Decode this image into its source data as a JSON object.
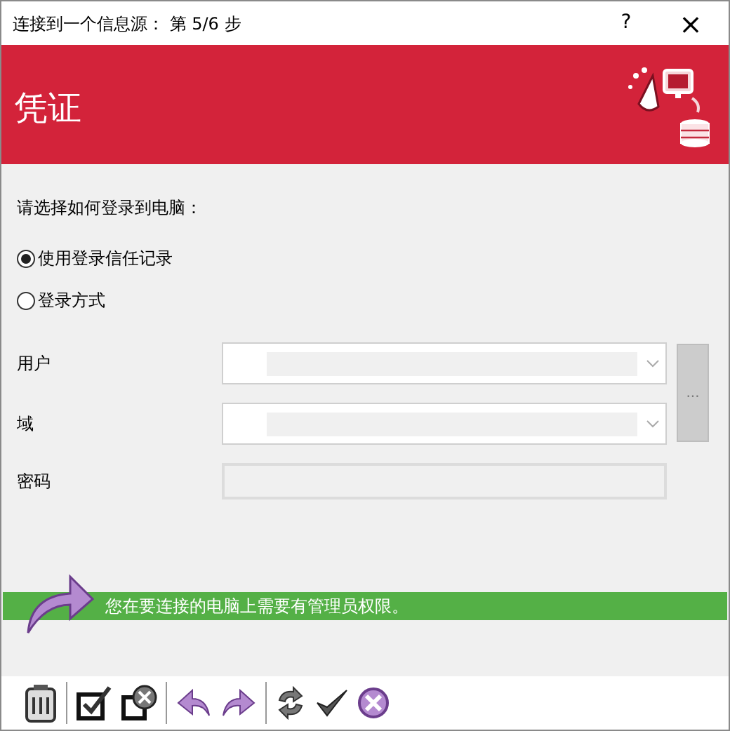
{
  "window": {
    "title": "连接到一个信息源： 第 5/6 步",
    "help": "?",
    "close": "×"
  },
  "header": {
    "title": "凭证"
  },
  "prompt": "请选择如何登录到电脑：",
  "login_options": [
    {
      "label": "使用登录信任记录",
      "selected": true
    },
    {
      "label": "登录方式",
      "selected": false
    }
  ],
  "fields": [
    {
      "label": "用户",
      "kind": "combo"
    },
    {
      "label": "域",
      "kind": "combo"
    },
    {
      "label": "密码",
      "kind": "text"
    }
  ],
  "browse_button": "...",
  "banner": "您在要连接的电脑上需要有管理员权限。"
}
